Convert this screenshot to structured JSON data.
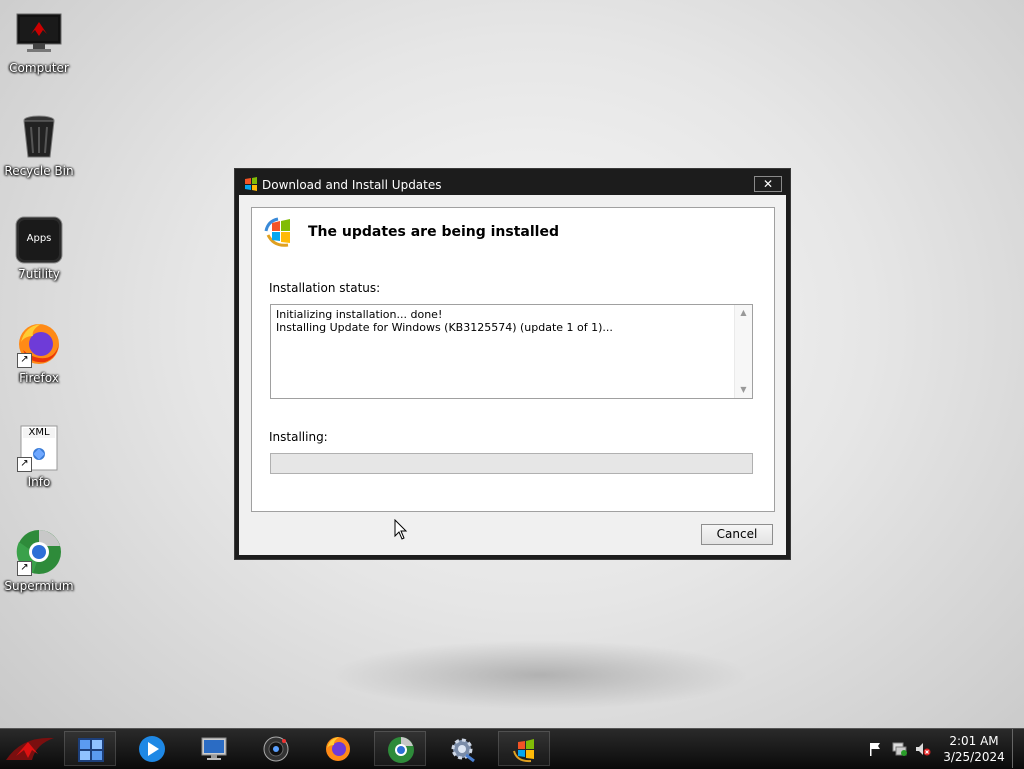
{
  "desktop": {
    "icons": [
      {
        "label": "Computer"
      },
      {
        "label": "Recycle Bin"
      },
      {
        "label": "7utility",
        "badge": "Apps"
      },
      {
        "label": "Firefox"
      },
      {
        "label": "Info",
        "badge": "XML"
      },
      {
        "label": "Supermium"
      }
    ]
  },
  "dialog": {
    "title": "Download and Install Updates",
    "close_glyph": "✕",
    "heading": "The updates are being installed",
    "status_label": "Installation status:",
    "log_lines": [
      "Initializing installation... done!",
      "Installing Update for Windows (KB3125574) (update 1 of 1)..."
    ],
    "installing_label": "Installing:",
    "progress_value": 0,
    "cancel_label": "Cancel"
  },
  "taskbar": {
    "apps": [
      {
        "name": "tile-manager-icon"
      },
      {
        "name": "media-player-icon"
      },
      {
        "name": "remote-desktop-icon"
      },
      {
        "name": "camera-icon"
      },
      {
        "name": "firefox-icon"
      },
      {
        "name": "supermium-icon"
      },
      {
        "name": "settings-icon"
      },
      {
        "name": "windows-update-icon"
      }
    ],
    "clock_time": "2:01 AM",
    "clock_date": "3/25/2024"
  },
  "colors": {
    "progress_green": "#06b025",
    "taskbar_bg": "#111111",
    "dialog_frame": "#1c1c1c"
  }
}
